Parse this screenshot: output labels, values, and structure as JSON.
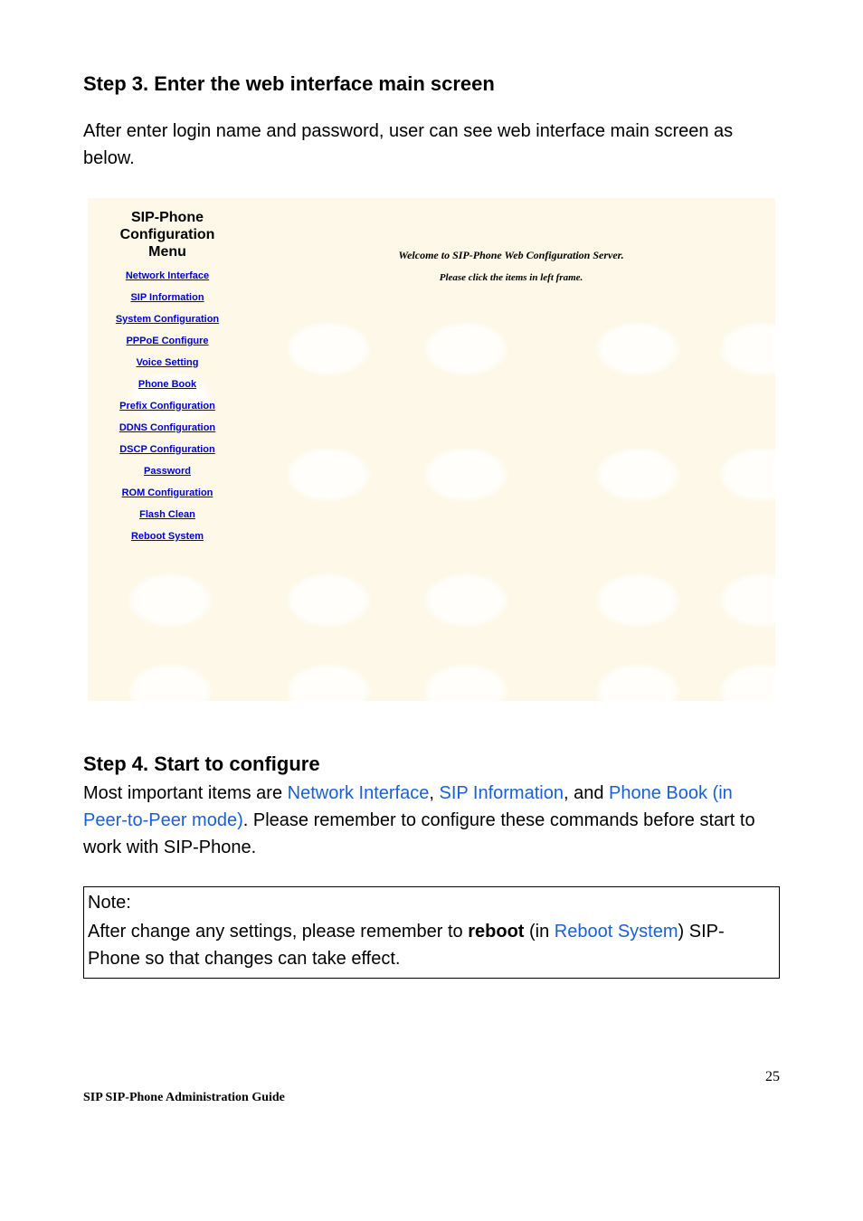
{
  "step3": {
    "title": "Step 3. Enter the web interface main screen",
    "para": "After enter login name and password, user can see web interface main screen as below."
  },
  "screenshot": {
    "menu_title_l1": "SIP-Phone",
    "menu_title_l2": "Configuration",
    "menu_title_l3": "Menu",
    "links": [
      "Network Interface",
      "SIP Information",
      "System Configuration",
      "PPPoE Configure",
      "Voice Setting",
      "Phone Book",
      "Prefix Configuration",
      "DDNS Configuration",
      "DSCP Configuration",
      "Password",
      "ROM Configuration",
      "Flash Clean",
      "Reboot System"
    ],
    "welcome": "Welcome to SIP-Phone Web Configuration Server.",
    "please": "Please click the items in left frame."
  },
  "step4": {
    "title": "Step 4. Start to configure",
    "line1_a": "Most important items are ",
    "link1": "Network Interface",
    "sep1": ", ",
    "link2": "SIP Information",
    "sep2": ", and ",
    "link3": "Phone Book (in Peer-to-Peer mode)",
    "line1_b": ". Please remember to configure these commands before start to work with SIP-Phone."
  },
  "note": {
    "label": "Note:",
    "a": "After change any settings, please remember to ",
    "reboot": "reboot",
    "b": " (in ",
    "link": "Reboot System",
    "c": ") SIP-Phone so that changes can take effect."
  },
  "footer": {
    "page_no": "25",
    "text": "SIP SIP-Phone    Administration Guide"
  }
}
